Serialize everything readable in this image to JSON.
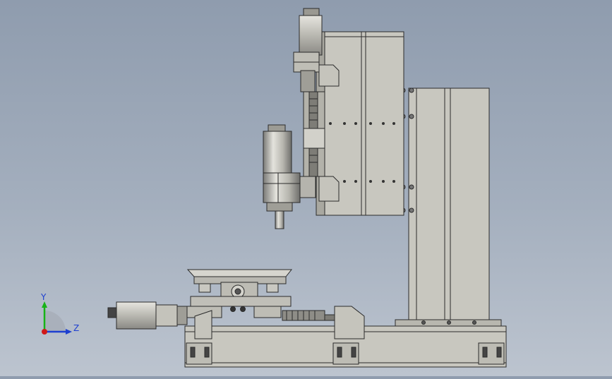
{
  "viewport": {
    "background_top": "#8f9cae",
    "background_bottom": "#bcc4cf",
    "model_fill": "#c8c7bf",
    "model_fill_dark": "#a9a8a0",
    "model_edge": "#2b2b2b"
  },
  "triad": {
    "y_label": "Y",
    "z_label": "Z",
    "y_color": "#17b317",
    "z_color": "#1d3fd0",
    "x_color": "#d01818"
  }
}
